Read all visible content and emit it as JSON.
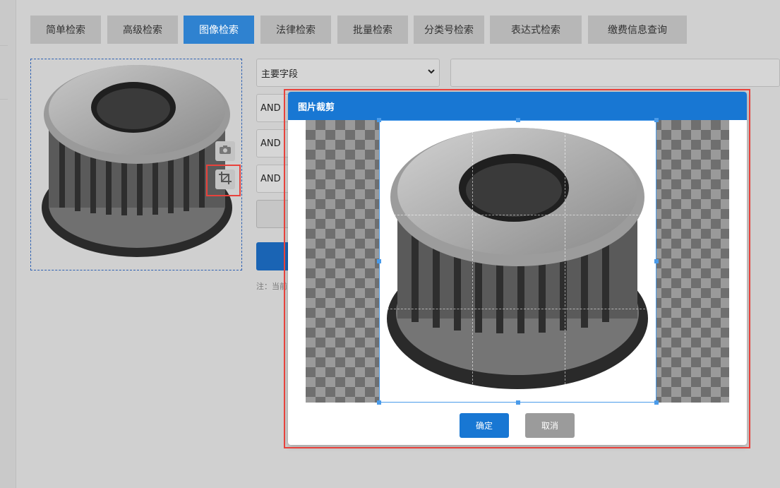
{
  "tabs": [
    {
      "label": "简单检索",
      "active": false
    },
    {
      "label": "高级检索",
      "active": false
    },
    {
      "label": "图像检索",
      "active": true
    },
    {
      "label": "法律检索",
      "active": false
    },
    {
      "label": "批量检索",
      "active": false
    },
    {
      "label": "分类号检索",
      "active": false
    },
    {
      "label": "表达式检索",
      "active": false
    },
    {
      "label": "缴费信息查询",
      "active": false
    }
  ],
  "image_panel": {
    "camera_icon": "camera-icon",
    "crop_icon": "crop-icon"
  },
  "form": {
    "field_select_value": "主要字段",
    "operators": [
      "AND",
      "AND",
      "AND"
    ],
    "note_prefix": "注：当前"
  },
  "modal": {
    "title": "图片裁剪",
    "confirm_label": "确定",
    "cancel_label": "取消"
  },
  "colors": {
    "accent": "#1877d3",
    "tab_active": "#2f82d0",
    "highlight": "#e8423c"
  }
}
